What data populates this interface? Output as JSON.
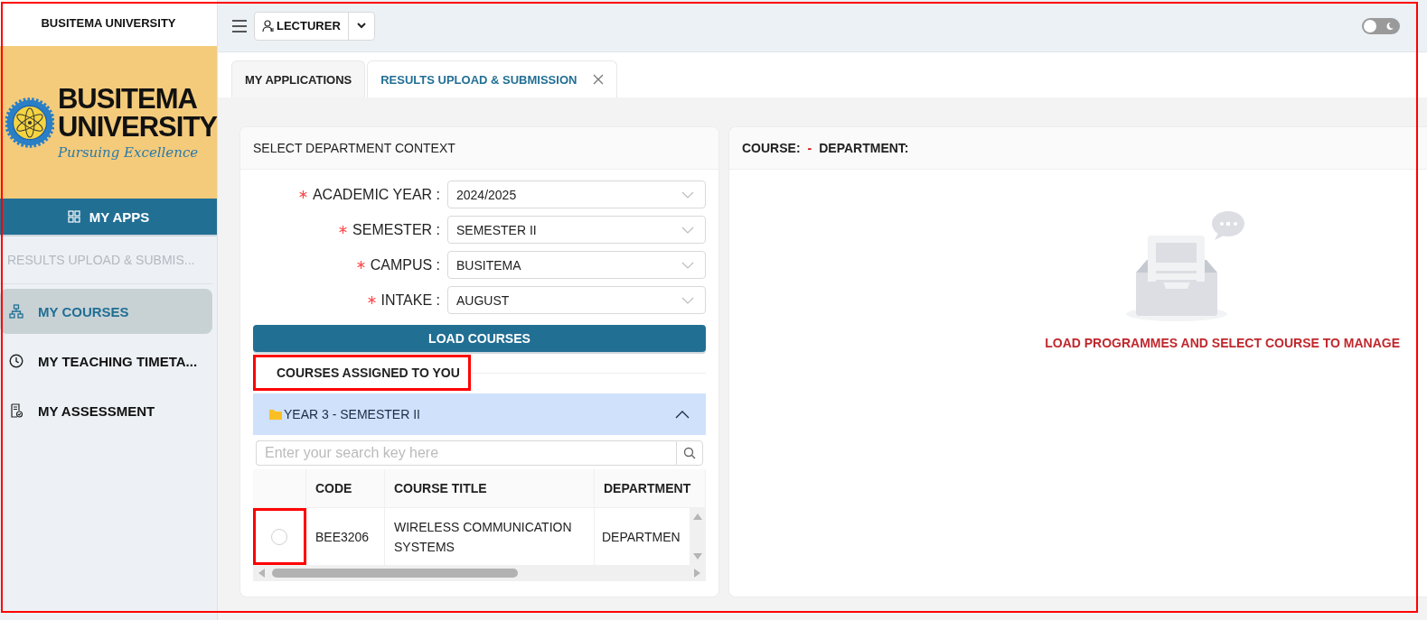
{
  "frame_highlighted": true,
  "sidebar": {
    "title": "BUSITEMA UNIVERSITY",
    "logo": {
      "line_1": "BUSITEMA",
      "line_2": "UNIVERSITY",
      "motto": "Pursuing Excellence"
    },
    "apps_button": "MY APPS",
    "section": "RESULTS UPLOAD & SUBMIS...",
    "items": [
      {
        "label": "MY COURSES",
        "selected": true
      },
      {
        "label": "MY TEACHING TIMETA...",
        "selected": false
      },
      {
        "label": "MY ASSESSMENT",
        "selected": false
      }
    ]
  },
  "topbar": {
    "role": "LECTURER",
    "theme_toggle": {
      "on": false
    }
  },
  "tabs": [
    {
      "label": "MY APPLICATIONS",
      "selected": false,
      "closable": false
    },
    {
      "label": "RESULTS UPLOAD & SUBMISSION",
      "selected": true,
      "closable": true
    }
  ],
  "context_panel": {
    "title": "SELECT DEPARTMENT CONTEXT",
    "fields": [
      {
        "label": "ACADEMIC YEAR :",
        "required": true,
        "value": "2024/2025"
      },
      {
        "label": "SEMESTER :",
        "required": true,
        "value": "SEMESTER II"
      },
      {
        "label": "CAMPUS :",
        "required": true,
        "value": "BUSITEMA"
      },
      {
        "label": "INTAKE :",
        "required": true,
        "value": "AUGUST"
      }
    ],
    "load_button": "LOAD COURSES",
    "courses_heading": {
      "text": "COURSES ASSIGNED TO YOU",
      "highlighted": true
    },
    "group": {
      "label": "YEAR 3 - SEMESTER II",
      "expanded": true
    },
    "search": {
      "placeholder": "Enter your search key here"
    },
    "table": {
      "columns": [
        "CODE",
        "COURSE TITLE",
        "DEPARTMENT"
      ],
      "rows": [
        {
          "selected": false,
          "highlighted": true,
          "cells": [
            "BEE3206",
            "WIRELESS COMMUNICATION SYSTEMS",
            "DEPARTMEN"
          ]
        }
      ]
    }
  },
  "course_panel": {
    "course_label": "COURSE:",
    "separator": "-",
    "department_label": "DEPARTMENT:",
    "empty_message": "LOAD PROGRAMMES AND SELECT COURSE TO MANAGE"
  }
}
